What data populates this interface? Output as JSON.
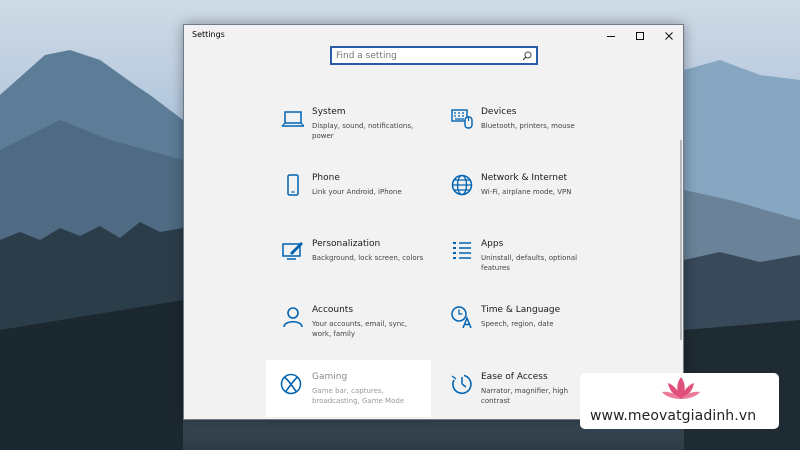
{
  "window": {
    "title": "Settings",
    "controls": [
      "minimize-icon",
      "maximize-icon",
      "close-icon"
    ]
  },
  "search": {
    "placeholder": "Find a setting"
  },
  "categories": [
    {
      "name": "System",
      "description": "Display, sound, notifications, power",
      "icon": "laptop-icon"
    },
    {
      "name": "Devices",
      "description": "Bluetooth, printers, mouse",
      "icon": "keyboard-icon"
    },
    {
      "name": "Phone",
      "description": "Link your Android, iPhone",
      "icon": "phone-icon"
    },
    {
      "name": "Network & Internet",
      "description": "Wi-Fi, airplane mode, VPN",
      "icon": "globe-icon"
    },
    {
      "name": "Personalization",
      "description": "Background, lock screen, colors",
      "icon": "paint-icon"
    },
    {
      "name": "Apps",
      "description": "Uninstall, defaults, optional features",
      "icon": "apps-list-icon"
    },
    {
      "name": "Accounts",
      "description": "Your accounts, email, sync, work, family",
      "icon": "person-icon"
    },
    {
      "name": "Time & Language",
      "description": "Speech, region, date",
      "icon": "time-language-icon"
    },
    {
      "name": "Gaming",
      "description": "Game bar, captures, broadcasting, Game Mode",
      "icon": "xbox-icon"
    },
    {
      "name": "Ease of Access",
      "description": "Narrator, magnifier, high contrast",
      "icon": "ease-of-access-icon"
    }
  ],
  "watermark": {
    "site": "www.meovatgiadinh.vn"
  },
  "colors": {
    "accent": "#0063b1",
    "search_border": "#2b5aa8",
    "lotus": "#e0507a"
  }
}
